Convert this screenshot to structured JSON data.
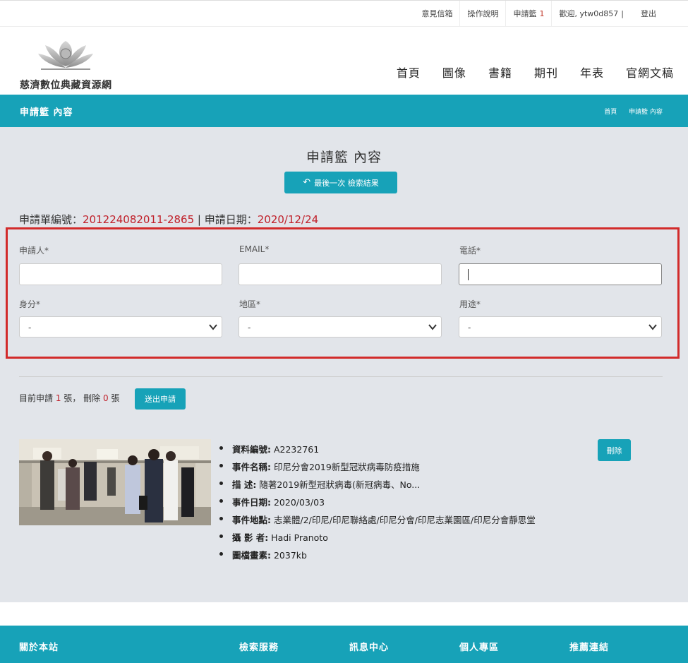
{
  "topbar": {
    "feedback": "意見信箱",
    "manual": "操作說明",
    "basket_label": "申請籃",
    "basket_count": "1",
    "welcome": "歡迎, ytw0d857",
    "separator": "|",
    "logout": "登出"
  },
  "header": {
    "logo_text": "慈濟數位典藏資源網",
    "nav": [
      "首頁",
      "圖像",
      "書籍",
      "期刊",
      "年表",
      "官網文稿"
    ]
  },
  "banner": {
    "title": "申請籃 內容",
    "breadcrumb": [
      "首頁",
      "申請籃 內容"
    ]
  },
  "main": {
    "page_title": "申請籃 內容",
    "back_button": "最後一次 檢索結果",
    "order_no_label": "申請單編號：",
    "order_no": "201224082011-2865",
    "date_sep": " | ",
    "date_label": "申請日期：",
    "date": "2020/12/24"
  },
  "form": {
    "applicant_label": "申請人*",
    "applicant_value": "",
    "email_label": "EMAIL*",
    "email_value": "",
    "phone_label": "電話*",
    "phone_value": "",
    "identity_label": "身分*",
    "identity_value": "-",
    "region_label": "地區*",
    "region_value": "-",
    "purpose_label": "用途*",
    "purpose_value": "-"
  },
  "summary": {
    "prefix": "目前申請",
    "count": "1",
    "unit1": "張，",
    "deleted_prefix": "刪除",
    "deleted": "0",
    "unit2": "張",
    "submit": "送出申請"
  },
  "item": {
    "delete_label": "刪除",
    "fields": [
      {
        "k": "資料編號:",
        "v": " A2232761"
      },
      {
        "k": "事件名稱:",
        "v": " 印尼分會2019新型冠狀病毒防疫措施"
      },
      {
        "k": "描 述:",
        "v": " 隨著2019新型冠狀病毒(新冠病毒、No..."
      },
      {
        "k": "事件日期:",
        "v": " 2020/03/03"
      },
      {
        "k": "事件地點:",
        "v": " 志業體/2/印尼/印尼聯絡處/印尼分會/印尼志業園區/印尼分會靜思堂"
      },
      {
        "k": "攝 影 者:",
        "v": " Hadi Pranoto"
      },
      {
        "k": "圖檔畫素:",
        "v": " 2037kb"
      }
    ]
  },
  "footer": {
    "about": "關於本站",
    "search": "檢索服務",
    "news": "訊息中心",
    "personal": "個人專區",
    "links": "推薦連結"
  },
  "colors": {
    "accent": "#17a2b8",
    "highlight_red": "#c0202a",
    "form_border": "#d22b2b",
    "main_bg": "#e2e5ea"
  }
}
